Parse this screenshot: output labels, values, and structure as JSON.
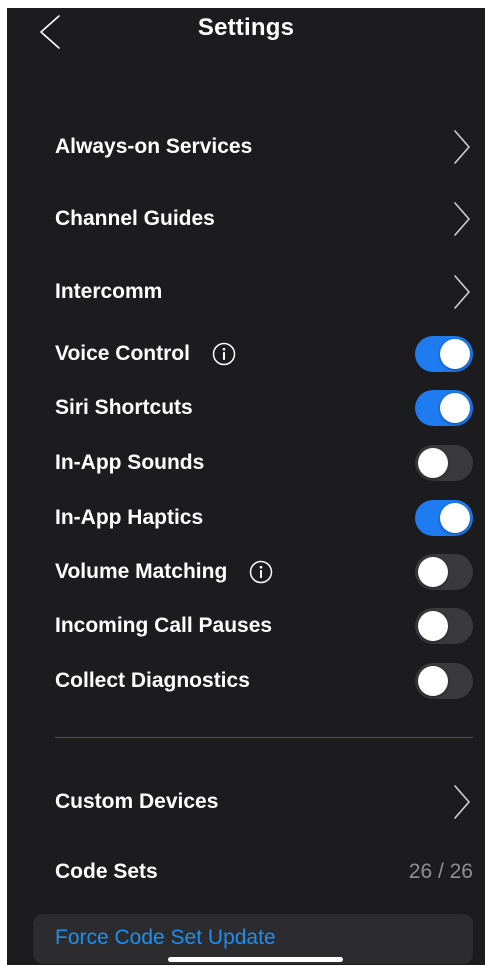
{
  "header": {
    "title": "Settings"
  },
  "nav_rows": [
    {
      "label": "Always-on Services"
    },
    {
      "label": "Channel Guides"
    },
    {
      "label": "Intercomm"
    }
  ],
  "toggles": [
    {
      "label": "Voice Control",
      "on": true,
      "info_icon": true
    },
    {
      "label": "Siri Shortcuts",
      "on": true,
      "info_icon": false
    },
    {
      "label": "In-App Sounds",
      "on": false,
      "info_icon": false
    },
    {
      "label": "In-App Haptics",
      "on": true,
      "info_icon": false
    },
    {
      "label": "Volume Matching",
      "on": false,
      "info_icon": true
    },
    {
      "label": "Incoming Call Pauses",
      "on": false,
      "info_icon": false
    },
    {
      "label": "Collect Diagnostics",
      "on": false,
      "info_icon": false
    }
  ],
  "devices": {
    "custom_devices_label": "Custom Devices",
    "code_sets_label": "Code Sets",
    "code_sets_value": "26 / 26",
    "force_update_label": "Force Code Set Update"
  },
  "colors": {
    "background": "#1c1c1e",
    "toggle_on": "#1e7bf0",
    "toggle_off": "#3a3a3c",
    "link": "#1e8ff0",
    "secondary_text": "#8e8e93"
  },
  "icons": {
    "back": "chevron-left-icon",
    "disclosure": "chevron-right-icon",
    "info": "info-circle-icon"
  }
}
